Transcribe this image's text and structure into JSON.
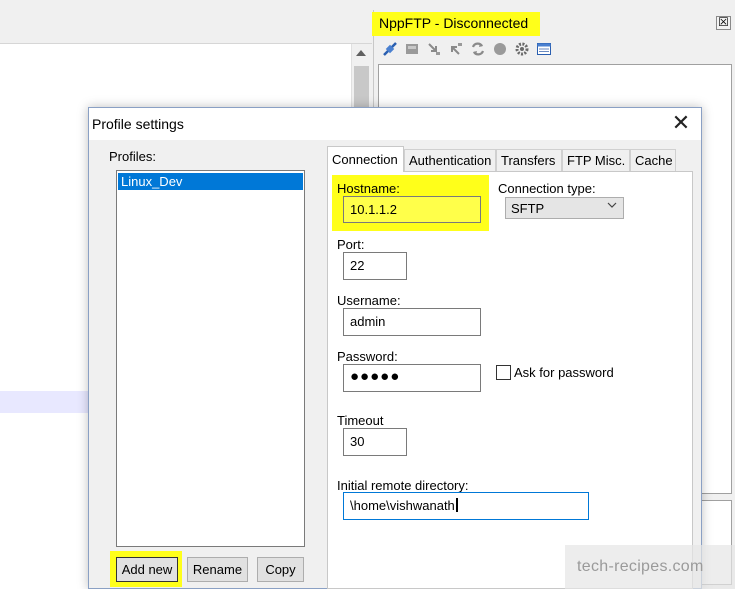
{
  "nppftp": {
    "title": "NppFTP - Disconnected",
    "close_glyph": "☒",
    "toolbar": [
      "connect-icon",
      "disconnect-icon",
      "download-icon",
      "upload-icon",
      "refresh-icon",
      "abort-icon",
      "settings-icon",
      "message-window-icon"
    ]
  },
  "dialog": {
    "title": "Profile settings",
    "close_glyph": "✕",
    "profiles_label": "Profiles:",
    "profiles": [
      "Linux_Dev"
    ],
    "buttons": {
      "add_new": "Add new",
      "rename": "Rename",
      "copy": "Copy"
    },
    "tabs": [
      "Connection",
      "Authentication",
      "Transfers",
      "FTP Misc.",
      "Cache"
    ],
    "active_tab": "Connection",
    "connection": {
      "hostname_label": "Hostname:",
      "hostname": "10.1.1.2",
      "conntype_label": "Connection type:",
      "conntype": "SFTP",
      "port_label": "Port:",
      "port": "22",
      "username_label": "Username:",
      "username": "admin",
      "password_label": "Password:",
      "password_mask": "●●●●●",
      "ask_password_label": "Ask for password",
      "ask_password_checked": false,
      "timeout_label": "Timeout",
      "timeout": "30",
      "remote_dir_label": "Initial remote directory:",
      "remote_dir": "\\home\\vishwanath"
    }
  },
  "watermark": "tech-recipes.com",
  "colors": {
    "highlight": "#ffff1a",
    "selection": "#0078d7"
  }
}
